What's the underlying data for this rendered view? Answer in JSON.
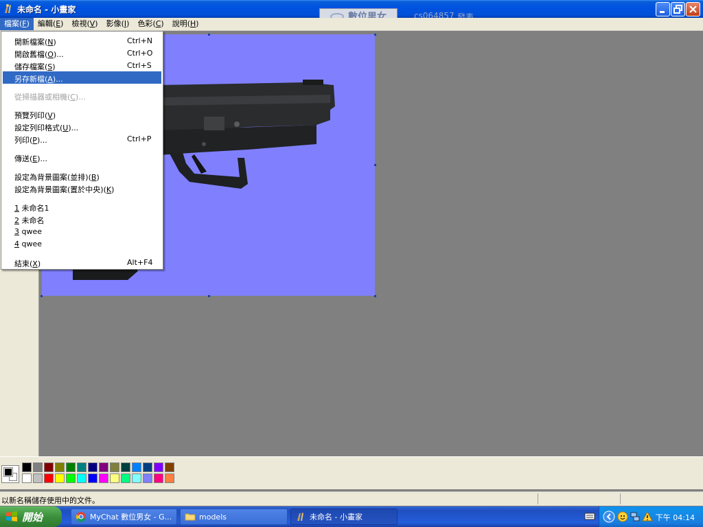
{
  "window": {
    "title": "未命名 - 小畫家"
  },
  "watermark": {
    "brand": "數位男女",
    "user": "cs064857",
    "link": "發表"
  },
  "menubar": {
    "items": [
      {
        "label": "檔案",
        "key": "F"
      },
      {
        "label": "編輯",
        "key": "E"
      },
      {
        "label": "檢視",
        "key": "V"
      },
      {
        "label": "影像",
        "key": "I"
      },
      {
        "label": "色彩",
        "key": "C"
      },
      {
        "label": "說明",
        "key": "H"
      }
    ]
  },
  "file_menu": {
    "items": [
      {
        "label": "開新檔案",
        "key": "N",
        "suffix": "",
        "shortcut": "Ctrl+N"
      },
      {
        "label": "開啟舊檔",
        "key": "O",
        "suffix": "...",
        "shortcut": "Ctrl+O"
      },
      {
        "label": "儲存檔案",
        "key": "S",
        "suffix": "",
        "shortcut": "Ctrl+S"
      },
      {
        "label": "另存新檔",
        "key": "A",
        "suffix": "...",
        "shortcut": "",
        "highlighted": true
      },
      {
        "label": "從掃描器或相機",
        "key": "C",
        "suffix": "...",
        "shortcut": "",
        "disabled": true
      },
      {
        "label": "預覽列印",
        "key": "V",
        "suffix": "",
        "shortcut": ""
      },
      {
        "label": "設定列印格式",
        "key": "U",
        "suffix": "...",
        "shortcut": ""
      },
      {
        "label": "列印",
        "key": "P",
        "suffix": "...",
        "shortcut": "Ctrl+P"
      },
      {
        "label": "傳送",
        "key": "E",
        "suffix": "...",
        "shortcut": ""
      },
      {
        "label": "設定為背景圖案(並排)",
        "key": "B",
        "suffix": "",
        "shortcut": ""
      },
      {
        "label": "設定為背景圖案(置於中央)",
        "key": "K",
        "suffix": "",
        "shortcut": ""
      },
      {
        "label": "未命名1",
        "key": "1",
        "suffix": "",
        "shortcut": "",
        "prefix": "1"
      },
      {
        "label": "未命名",
        "key": "2",
        "suffix": "",
        "shortcut": "",
        "prefix": "2"
      },
      {
        "label": "qwee",
        "key": "3",
        "suffix": "",
        "shortcut": "",
        "prefix": "3"
      },
      {
        "label": "qwee",
        "key": "4",
        "suffix": "",
        "shortcut": "",
        "prefix": "4"
      },
      {
        "label": "結束",
        "key": "X",
        "suffix": "",
        "shortcut": "Alt+F4"
      }
    ]
  },
  "status": {
    "text": "以新名稱儲存使用中的文件。"
  },
  "palette": {
    "colors": [
      "#000000",
      "#808080",
      "#800000",
      "#808000",
      "#008000",
      "#008080",
      "#000080",
      "#800080",
      "#808040",
      "#004040",
      "#0080ff",
      "#004080",
      "#8000ff",
      "#804000",
      "#ffffff",
      "#c0c0c0",
      "#ff0000",
      "#ffff00",
      "#00ff00",
      "#00ffff",
      "#0000ff",
      "#ff00ff",
      "#ffff80",
      "#00ff80",
      "#80ffff",
      "#8080ff",
      "#ff0080",
      "#ff8040"
    ],
    "foreground": "#000000",
    "background": "#ffffff"
  },
  "taskbar": {
    "start_label": "開始",
    "tasks": [
      {
        "label": "MyChat 數位男女 - G...",
        "icon": "chrome-icon"
      },
      {
        "label": "models",
        "icon": "folder-icon"
      },
      {
        "label": "未命名 - 小畫家",
        "icon": "paint-icon",
        "active": true
      }
    ],
    "clock": "下午 04:14"
  },
  "canvas": {
    "background": "#8080ff"
  }
}
